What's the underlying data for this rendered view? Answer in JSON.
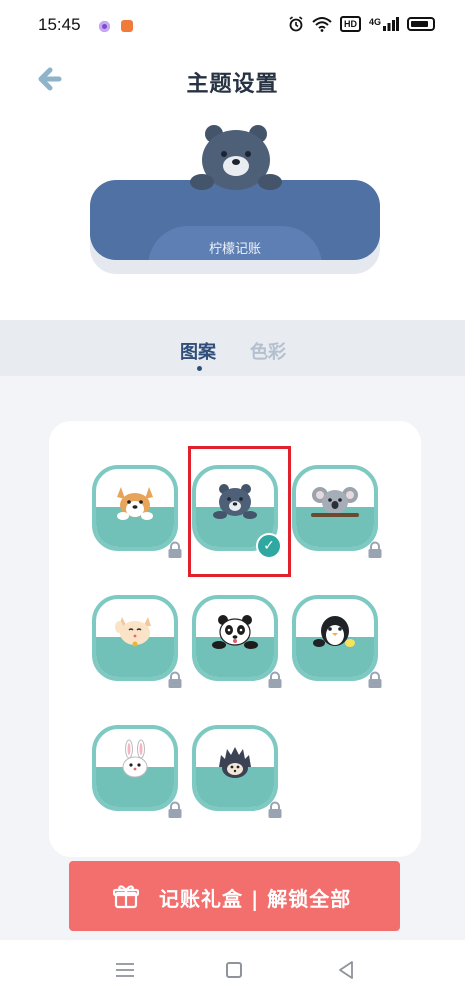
{
  "status_bar": {
    "time": "15:45",
    "network": "4G",
    "icons": [
      "purple-app-icon",
      "orange-app-icon",
      "alarm-icon",
      "wifi-icon",
      "hd-icon",
      "signal-icon",
      "battery-icon"
    ],
    "hd_label": "HD"
  },
  "header": {
    "title": "主题设置",
    "back_icon": "back-arrow-icon"
  },
  "preview": {
    "label": "柠檬记账",
    "mascot": "bear",
    "card_color": "#4f71a3"
  },
  "tabs": [
    {
      "label": "图案",
      "active": true
    },
    {
      "label": "色彩",
      "active": false
    }
  ],
  "themes": [
    {
      "animal": "corgi",
      "locked": true,
      "selected": false
    },
    {
      "animal": "bear",
      "locked": false,
      "selected": true
    },
    {
      "animal": "koala",
      "locked": true,
      "selected": false
    },
    {
      "animal": "cat",
      "locked": true,
      "selected": false
    },
    {
      "animal": "panda",
      "locked": true,
      "selected": false
    },
    {
      "animal": "penguin",
      "locked": true,
      "selected": false
    },
    {
      "animal": "rabbit",
      "locked": true,
      "selected": false
    },
    {
      "animal": "hedgehog",
      "locked": true,
      "selected": false
    }
  ],
  "action_button": {
    "label": "记账礼盒 | 解锁全部",
    "icon": "gift-icon",
    "color": "#f36f6d"
  },
  "colors": {
    "accent": "#72c1b8",
    "frame": "#7ec9c2",
    "selected_check": "#2fa8a1",
    "highlight_box": "#e0202a"
  },
  "nav_bar": {
    "icons": [
      "menu-icon",
      "home-icon",
      "back-icon"
    ]
  }
}
